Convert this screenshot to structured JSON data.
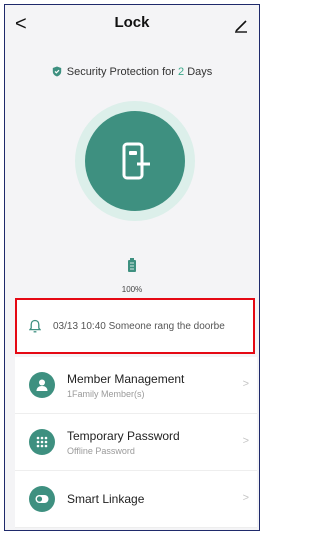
{
  "header": {
    "title": "Lock",
    "back_glyph": "<",
    "edit_icon": "pencil-icon"
  },
  "security": {
    "prefix": "Security Protection for ",
    "days": "2",
    "suffix": " Days"
  },
  "battery": {
    "level_text": "100%"
  },
  "notification": {
    "text": "03/13 10:40 Someone rang the doorbe"
  },
  "menu": {
    "items": [
      {
        "title": "Member Management",
        "subtitle": "1Family Member(s)",
        "icon": "person-icon"
      },
      {
        "title": "Temporary Password",
        "subtitle": "Offline Password",
        "icon": "keypad-icon"
      },
      {
        "title": "Smart Linkage",
        "subtitle": "",
        "icon": "toggle-icon"
      }
    ]
  },
  "colors": {
    "accent": "#3e9080",
    "accent_light": "#dcefea",
    "days_color": "#3aa889",
    "highlight_border": "#e50914"
  }
}
